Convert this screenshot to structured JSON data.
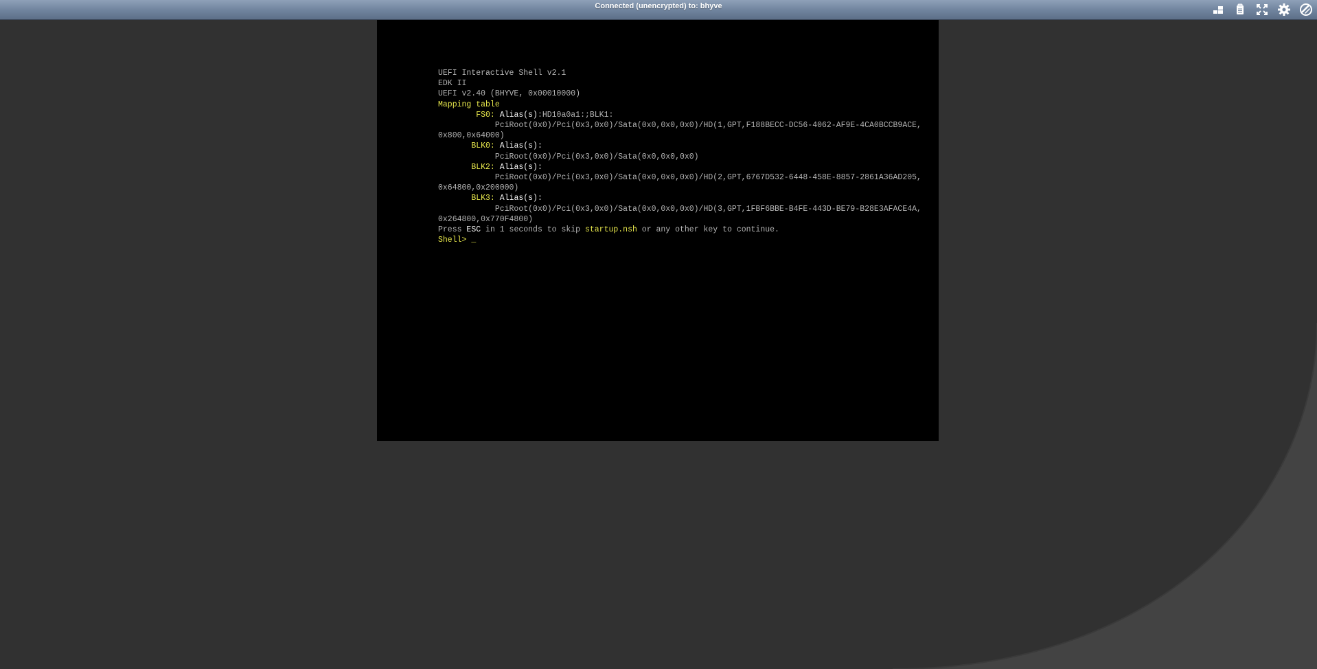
{
  "status_bar": {
    "title": "Connected (unencrypted) to: bhyve"
  },
  "toolbar": {
    "buttons": [
      {
        "name": "send-keys",
        "icon": "keyboard-keys-icon"
      },
      {
        "name": "clipboard",
        "icon": "clipboard-icon"
      },
      {
        "name": "fullscreen",
        "icon": "fullscreen-icon"
      },
      {
        "name": "settings",
        "icon": "gear-icon"
      },
      {
        "name": "disconnect",
        "icon": "disconnect-icon"
      }
    ]
  },
  "console": {
    "line1": "UEFI Interactive Shell v2.1",
    "line2": "EDK II",
    "line3": "UEFI v2.40 (BHYVE, 0x00010000)",
    "mapping_title": "Mapping table",
    "fs0_label": "FS0:",
    "fs0_alias_word": "Alias(s)",
    "fs0_alias_rest": ":HD10a0a1:;BLK1:",
    "fs0_path": "PciRoot(0x0)/Pci(0x3,0x0)/Sata(0x0,0x0,0x0)/HD(1,GPT,F188BECC-DC56-4062-AF9E-4CA0BCCB9ACE,",
    "fs0_path_cont": "0x800,0x64000)",
    "blk0_label": "BLK0:",
    "blk0_alias": "Alias(s):",
    "blk0_path": "PciRoot(0x0)/Pci(0x3,0x0)/Sata(0x0,0x0,0x0)",
    "blk2_label": "BLK2:",
    "blk2_alias": "Alias(s):",
    "blk2_path": "PciRoot(0x0)/Pci(0x3,0x0)/Sata(0x0,0x0,0x0)/HD(2,GPT,6767D532-6448-458E-8857-2861A36AD205,",
    "blk2_path_cont": "0x64800,0x200000)",
    "blk3_label": "BLK3:",
    "blk3_alias": "Alias(s):",
    "blk3_path": "PciRoot(0x0)/Pci(0x3,0x0)/Sata(0x0,0x0,0x0)/HD(3,GPT,1FBF6BBE-B4FE-443D-BE79-B28E3AFACE4A,",
    "blk3_path_cont": "0x264800,0x770F4800)",
    "press_1": "Press ",
    "press_esc": "ESC",
    "press_2": " in 1 seconds to skip ",
    "press_file": "startup.nsh",
    "press_3": " or any other key to continue.",
    "prompt": "Shell> ",
    "cursor": "_"
  },
  "colors": {
    "background": "#313131",
    "background_curve": "#434343",
    "console_bg": "#000000",
    "console_text": "#b4b4b4",
    "console_highlight": "#e8e84c",
    "console_bright": "#f4f4f4",
    "status_bar": "#6f839d"
  }
}
